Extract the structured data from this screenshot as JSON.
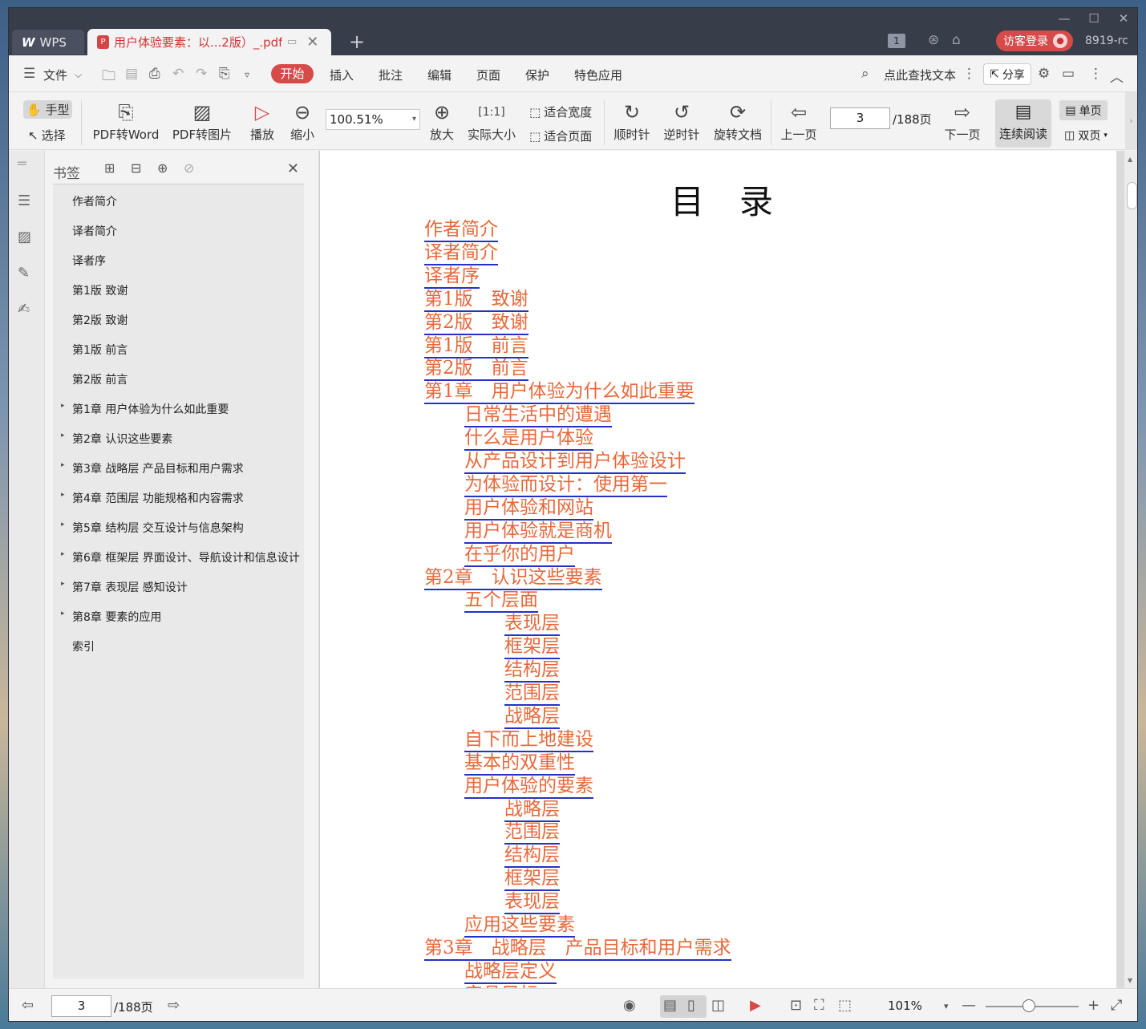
{
  "tabbar": {
    "wps_label": "WPS",
    "doc_tab_title": "用户体验要素：以...2版）_.pdf",
    "badge": "1",
    "login_label": "访客登录",
    "user_id": "8919-rc"
  },
  "menu": {
    "file": "文件",
    "items": [
      "开始",
      "插入",
      "批注",
      "编辑",
      "页面",
      "保护",
      "特色应用"
    ],
    "search": "点此查找文本",
    "share": "分享"
  },
  "toolbar": {
    "hand": "手型",
    "select": "选择",
    "pdf_to_word": "PDF转Word",
    "pdf_to_image": "PDF转图片",
    "play": "播放",
    "zoom_out": "缩小",
    "zoom_value": "100.51%",
    "zoom_in": "放大",
    "actual_size": "实际大小",
    "fit_width": "适合宽度",
    "fit_page": "适合页面",
    "clockwise": "顺时针",
    "counterclockwise": "逆时针",
    "rotate_doc": "旋转文档",
    "prev_page": "上一页",
    "page_value": "3",
    "page_total": "/188页",
    "next_page": "下一页",
    "continuous": "连续阅读",
    "single": "单页",
    "double": "双页"
  },
  "bookmark": {
    "title": "书签",
    "items": [
      {
        "label": "作者简介",
        "expandable": false
      },
      {
        "label": "译者简介",
        "expandable": false
      },
      {
        "label": "译者序",
        "expandable": false
      },
      {
        "label": "第1版 致谢",
        "expandable": false
      },
      {
        "label": "第2版 致谢",
        "expandable": false
      },
      {
        "label": "第1版 前言",
        "expandable": false
      },
      {
        "label": "第2版 前言",
        "expandable": false
      },
      {
        "label": "第1章 用户体验为什么如此重要",
        "expandable": true
      },
      {
        "label": "第2章 认识这些要素",
        "expandable": true
      },
      {
        "label": "第3章 战略层 产品目标和用户需求",
        "expandable": true
      },
      {
        "label": "第4章 范围层 功能规格和内容需求",
        "expandable": true
      },
      {
        "label": "第5章 结构层 交互设计与信息架构",
        "expandable": true
      },
      {
        "label": "第6章 框架层 界面设计、导航设计和信息设计",
        "expandable": true
      },
      {
        "label": "第7章 表现层 感知设计",
        "expandable": true
      },
      {
        "label": "第8章 要素的应用",
        "expandable": true
      },
      {
        "label": "索引",
        "expandable": false
      }
    ]
  },
  "document": {
    "title": "目录",
    "toc": [
      {
        "text": "作者简介",
        "level": 0
      },
      {
        "text": "译者简介",
        "level": 0
      },
      {
        "text": "译者序",
        "level": 0
      },
      {
        "text": "第1版　致谢",
        "level": 0
      },
      {
        "text": "第2版　致谢",
        "level": 0
      },
      {
        "text": "第1版　前言",
        "level": 0
      },
      {
        "text": "第2版　前言",
        "level": 0
      },
      {
        "text": "第1章　用户体验为什么如此重要",
        "level": 0
      },
      {
        "text": "日常生活中的遭遇",
        "level": 1
      },
      {
        "text": "什么是用户体验",
        "level": 1
      },
      {
        "text": "从产品设计到用户体验设计",
        "level": 1
      },
      {
        "text": "为体验而设计：使用第一",
        "level": 1
      },
      {
        "text": "用户体验和网站",
        "level": 1
      },
      {
        "text": "用户体验就是商机",
        "level": 1
      },
      {
        "text": "在乎你的用户",
        "level": 1
      },
      {
        "text": "第2章　认识这些要素",
        "level": 0
      },
      {
        "text": "五个层面",
        "level": 1
      },
      {
        "text": "表现层",
        "level": 2
      },
      {
        "text": "框架层",
        "level": 2
      },
      {
        "text": "结构层",
        "level": 2
      },
      {
        "text": "范围层",
        "level": 2
      },
      {
        "text": "战略层",
        "level": 2
      },
      {
        "text": "自下而上地建设",
        "level": 1
      },
      {
        "text": "基本的双重性",
        "level": 1
      },
      {
        "text": "用户体验的要素",
        "level": 1
      },
      {
        "text": "战略层",
        "level": 2
      },
      {
        "text": "范围层",
        "level": 2
      },
      {
        "text": "结构层",
        "level": 2
      },
      {
        "text": "框架层",
        "level": 2
      },
      {
        "text": "表现层",
        "level": 2
      },
      {
        "text": "应用这些要素",
        "level": 1
      },
      {
        "text": "第3章　战略层　产品目标和用户需求",
        "level": 0
      },
      {
        "text": "战略层定义",
        "level": 1
      },
      {
        "text": "产品目标",
        "level": 1
      }
    ]
  },
  "statusbar": {
    "page_value": "3",
    "page_total": "/188页",
    "zoom_value": "101%"
  },
  "colors": {
    "accent": "#d64a4a",
    "link_text": "#e8683a",
    "link_underline": "#2431c7"
  }
}
